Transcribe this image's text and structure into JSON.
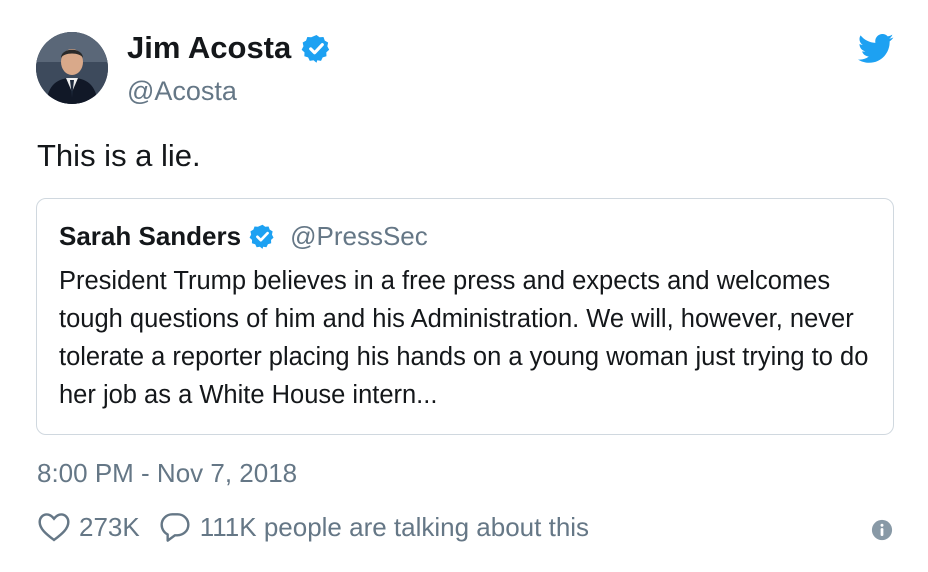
{
  "tweet": {
    "author_name": "Jim Acosta",
    "author_handle": "@Acosta",
    "text": "This is a lie.",
    "timestamp": "8:00 PM - Nov 7, 2018",
    "likes": "273K",
    "talking": "111K people are talking about this"
  },
  "quoted": {
    "author_name": "Sarah Sanders",
    "author_handle": "@PressSec",
    "text": "President Trump believes in a free press and expects and welcomes tough questions of him and his Administration. We will, however, never tolerate a reporter placing his hands on a young woman just trying to do her job as a White House intern..."
  },
  "icons": {
    "verified": "verified-badge-icon",
    "twitter": "twitter-bird-icon",
    "like": "heart-icon",
    "reply": "reply-bubble-icon",
    "info": "info-icon"
  },
  "colors": {
    "twitter_blue": "#1da1f2",
    "secondary_text": "#657786",
    "border": "#d0d8df"
  }
}
